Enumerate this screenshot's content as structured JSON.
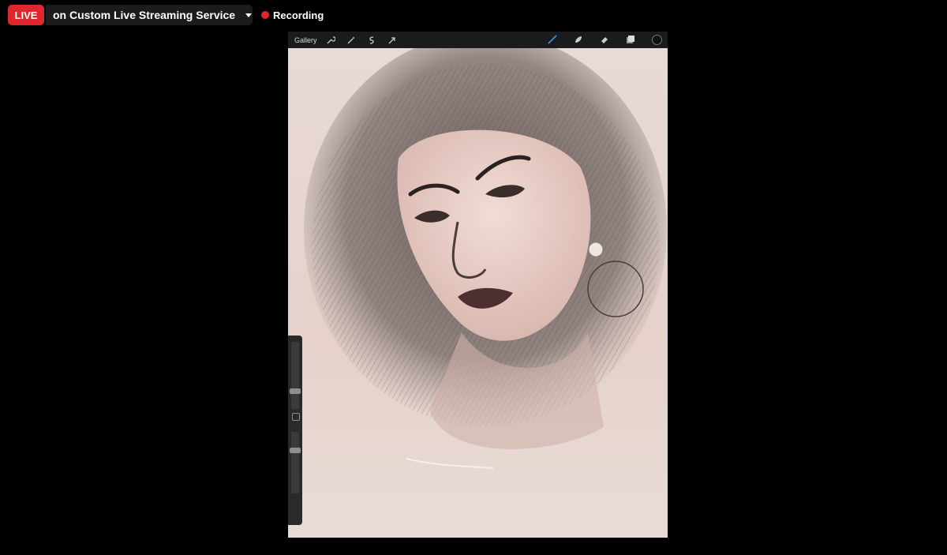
{
  "live": {
    "badge_label": "LIVE",
    "stream_target": "on Custom Live Streaming Service"
  },
  "recording": {
    "label": "Recording",
    "dot_color": "#e0272f"
  },
  "app": {
    "toolbar": {
      "gallery_label": "Gallery",
      "left_tools": [
        "wrench-icon",
        "magic-wand-icon",
        "selection-icon",
        "transform-arrow-icon"
      ],
      "right_tools": [
        "brush-icon",
        "smudge-icon",
        "eraser-icon",
        "layers-icon",
        "color-swatch"
      ],
      "active_tool_color": "#3a8ee6"
    },
    "sidebar": {
      "brush_size_level": 0.7,
      "opacity_level": 0.5
    }
  },
  "accent": "#e0272f"
}
